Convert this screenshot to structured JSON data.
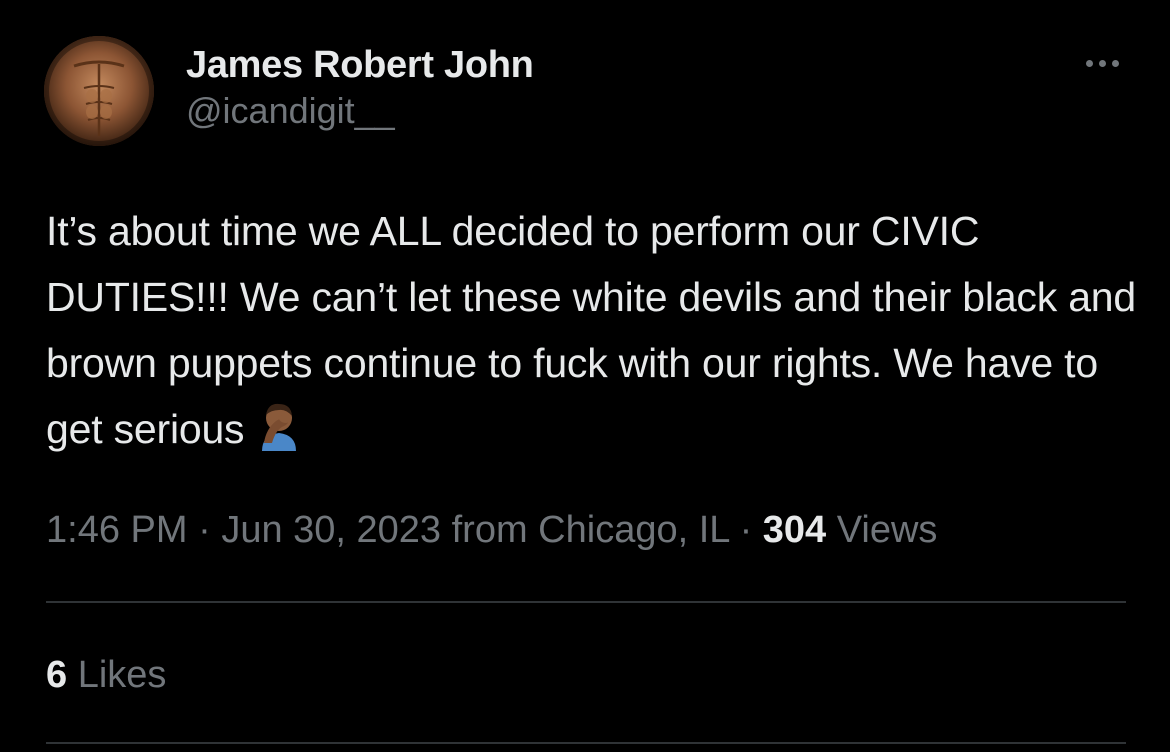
{
  "author": {
    "display_name": "James Robert John",
    "handle": "@icandigit__"
  },
  "tweet": {
    "text": "It’s about time we ALL decided to perform our CIVIC DUTIES!!! We can’t let these white devils and their black and brown puppets continue to fuck with our rights. We have to get serious",
    "emoji": "man-facepalming-medium-dark-skin-tone",
    "time": "1:46 PM",
    "separator": "·",
    "date": "Jun 30, 2023",
    "location": "from Chicago, IL",
    "views_count": "304",
    "views_label": "Views"
  },
  "engagement": {
    "likes_count": "6",
    "likes_label": "Likes"
  },
  "icons": {
    "more": "more-horizontal-icon",
    "avatar": "profile-photo"
  },
  "colors": {
    "background": "#000000",
    "primary_text": "#e7e9ea",
    "secondary_text": "#71767b",
    "divider": "#2f3336"
  }
}
